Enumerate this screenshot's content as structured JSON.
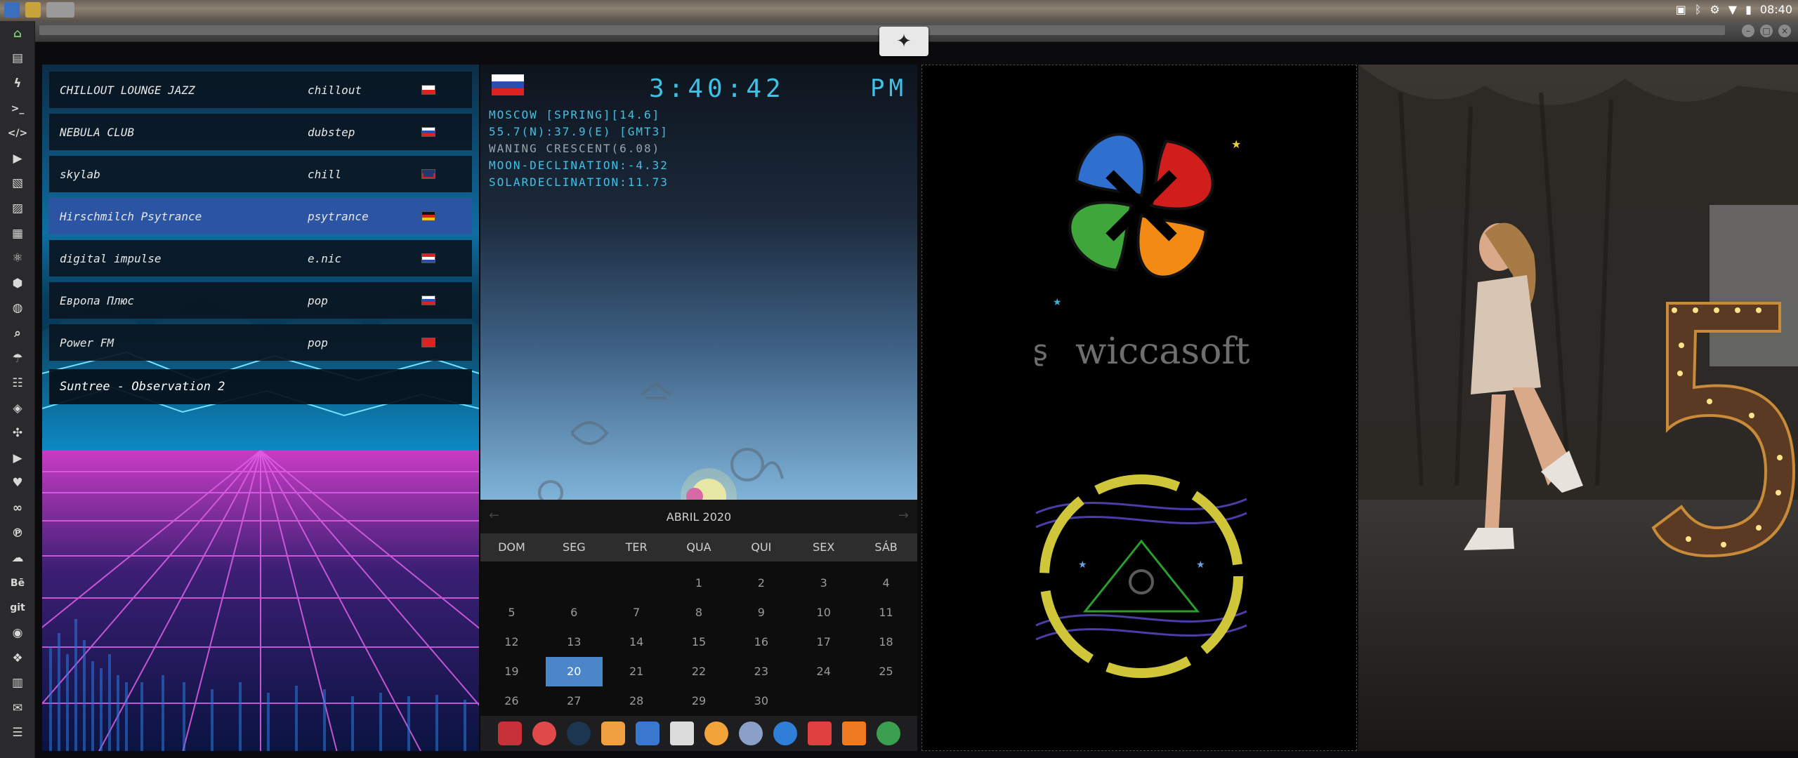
{
  "system": {
    "clock": "08:40"
  },
  "radio": {
    "stations": [
      {
        "name": "CHILLOUT LOUNGE JAZZ",
        "genre": "chillout",
        "flag": "poland"
      },
      {
        "name": "NEBULA CLUB",
        "genre": "dubstep",
        "flag": "russia"
      },
      {
        "name": "skylab",
        "genre": "chill",
        "flag": "uk"
      },
      {
        "name": "Hirschmilch Psytrance",
        "genre": "psytrance",
        "flag": "germany",
        "selected": true
      },
      {
        "name": "digital impulse",
        "genre": "e.nic",
        "flag": "croatia"
      },
      {
        "name": "Европа Плюс",
        "genre": "pop",
        "flag": "russia"
      },
      {
        "name": "Power FM",
        "genre": "pop",
        "flag": "turkey"
      }
    ],
    "now_playing": "Suntree - Observation 2"
  },
  "astro": {
    "time": "3:40:42",
    "ampm": "PM",
    "location": "MOSCOW [SPRING][14.6]",
    "coords": "55.7(N):37.9(E) [GMT3]",
    "moon_phase": "WANING CRESCENT(6.08)",
    "moon_declination": "MOON-DECLINATION:-4.32",
    "solar_declination": "SOLARDECLINATION:11.73"
  },
  "calendar": {
    "month_label": "ABRIL 2020",
    "weekdays": [
      "DOM",
      "SEG",
      "TER",
      "QUA",
      "QUI",
      "SEX",
      "SÁB"
    ],
    "cells": [
      "",
      "",
      "",
      "1",
      "2",
      "3",
      "4",
      "5",
      "6",
      "7",
      "8",
      "9",
      "10",
      "11",
      "12",
      "13",
      "14",
      "15",
      "16",
      "17",
      "18",
      "19",
      "20",
      "21",
      "22",
      "23",
      "24",
      "25",
      "26",
      "27",
      "28",
      "29",
      "30",
      "",
      ""
    ],
    "today": "20"
  },
  "wicca": {
    "brand": "wiccasoft"
  },
  "colors": {
    "cyan": "#3fc1e6",
    "selection": "#2b55a3",
    "today": "#4a86c8",
    "petal_green": "#3ea63a",
    "petal_blue": "#2f6fd0",
    "petal_orange": "#f28a13",
    "petal_red": "#d21d1d",
    "ring": "#cfc63a"
  },
  "icons": {
    "dock": [
      "home-icon",
      "document-icon",
      "bolt-icon",
      "terminal-icon",
      "code-icon",
      "play-icon",
      "files-icon",
      "image-icon",
      "news-icon",
      "atom-icon",
      "hexagon-icon",
      "globe-icon",
      "search-icon",
      "umbrella-icon",
      "contact-icon",
      "tag-icon",
      "puzzle-icon",
      "youtube-icon",
      "heart-icon",
      "link-icon",
      "pinterest-icon",
      "cloud-icon",
      "behance-icon",
      "git-icon",
      "github-icon",
      "cubes-icon",
      "map-icon",
      "mail-icon",
      "server-icon"
    ]
  }
}
